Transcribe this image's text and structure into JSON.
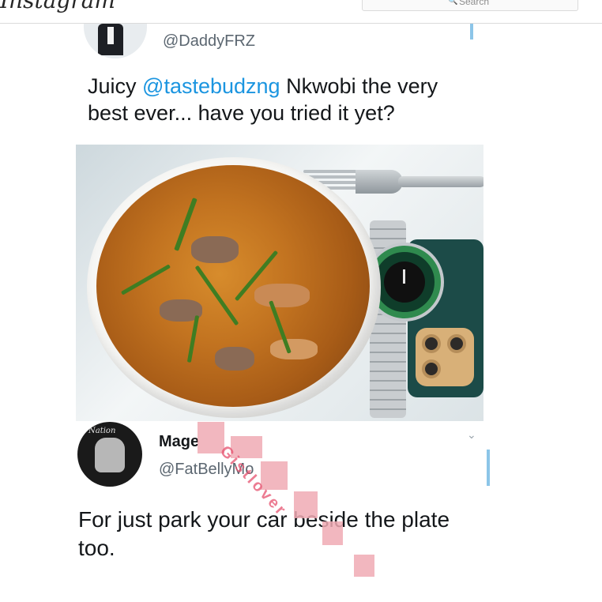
{
  "app": {
    "logo_text": "Instagram",
    "search_placeholder": "Search"
  },
  "tweet": {
    "handle": "@DaddyFRZ",
    "text_prefix": "Juicy ",
    "mention": "@tastebudzng",
    "text_suffix": " Nkwobi the very best ever... have you tried it yet?",
    "image_alt": "bowl of nkwobi with fork, watch and phone"
  },
  "reply": {
    "name": "Mage",
    "handle": "@FatBellyMo",
    "text": "For just park your car beside the plate too.",
    "avatar_logo": "Nation"
  },
  "watermark": {
    "text": "Gistlover"
  },
  "colors": {
    "mention": "#1b95e0",
    "handle_gray": "#5b6670",
    "accent_tick": "#8cc5e8"
  }
}
